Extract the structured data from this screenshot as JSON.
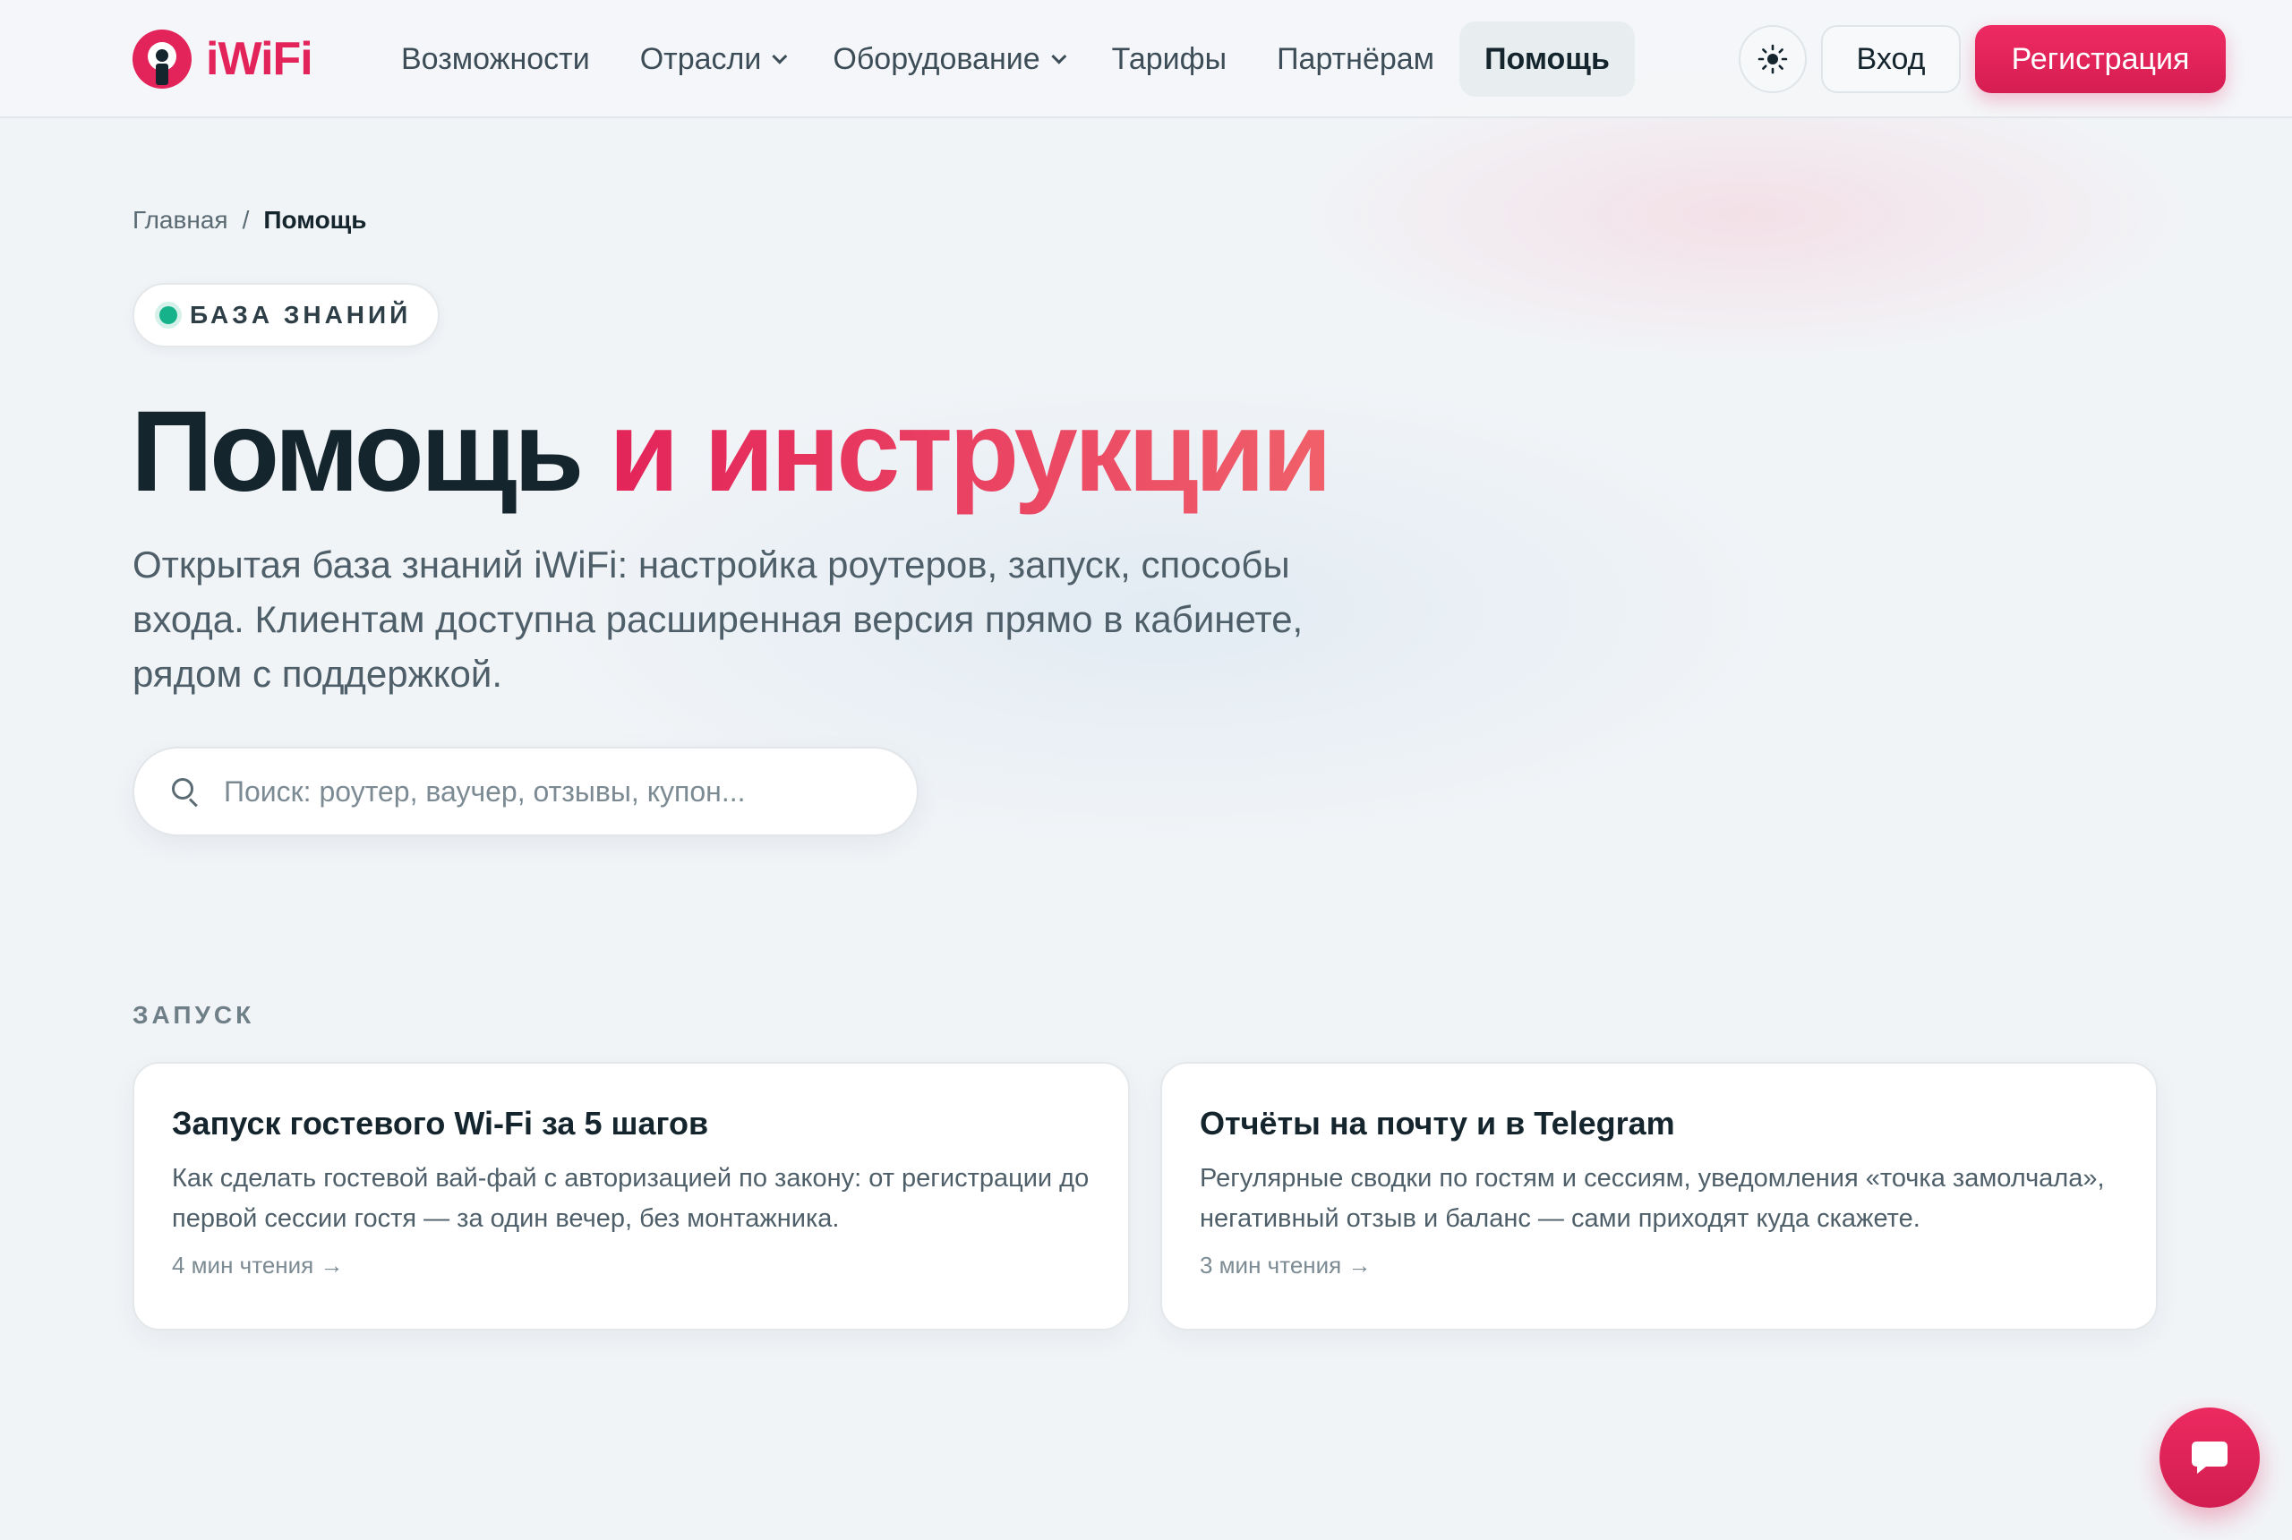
{
  "brand": {
    "name": "iWiFi",
    "accent": "#e3245a"
  },
  "nav": {
    "items": [
      {
        "label": "Возможности",
        "dropdown": false,
        "active": false
      },
      {
        "label": "Отрасли",
        "dropdown": true,
        "active": false
      },
      {
        "label": "Оборудование",
        "dropdown": true,
        "active": false
      },
      {
        "label": "Тарифы",
        "dropdown": false,
        "active": false
      },
      {
        "label": "Партнёрам",
        "dropdown": false,
        "active": false
      },
      {
        "label": "Помощь",
        "dropdown": false,
        "active": true
      }
    ],
    "theme_icon": "sun-icon",
    "login_label": "Вход",
    "register_label": "Регистрация"
  },
  "breadcrumb": {
    "home": "Главная",
    "separator": "/",
    "current": "Помощь"
  },
  "badge": {
    "label": "БАЗА ЗНАНИЙ",
    "dot_color": "#16b38a"
  },
  "hero": {
    "title_dark": "Помощь",
    "title_accent": "и инструкции",
    "lead": "Открытая база знаний iWiFi: настройка роутеров, запуск, способы входа. Клиентам доступна расширенная версия прямо в кабинете, рядом с поддержкой."
  },
  "search": {
    "placeholder": "Поиск: роутер, ваучер, отзывы, купон...",
    "value": ""
  },
  "section": {
    "label": "ЗАПУСК",
    "cards": [
      {
        "title": "Запуск гостевого Wi-Fi за 5 шагов",
        "description": "Как сделать гостевой вай-фай с авторизацией по закону: от регистрации до первой сессии гостя — за один вечер, без монтажника.",
        "meta": "4 мин чтения →"
      },
      {
        "title": "Отчёты на почту и в Telegram",
        "description": "Регулярные сводки по гостям и сессиям, уведомления «точка замолчала», негативный отзыв и баланс — сами приходят куда скажете.",
        "meta": "3 мин чтения →"
      }
    ]
  },
  "chat": {
    "icon": "chat-icon"
  }
}
